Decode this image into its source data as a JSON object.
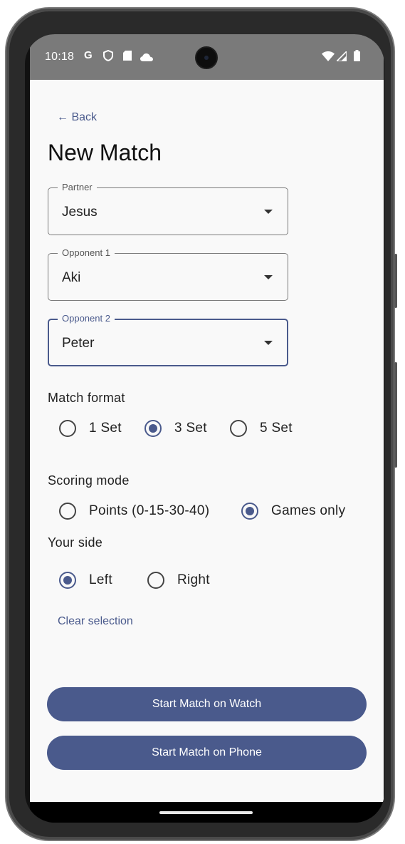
{
  "status_bar": {
    "time": "10:18",
    "left_icons": [
      "google-g-icon",
      "shield-icon",
      "sd-card-icon",
      "cloud-icon"
    ],
    "right_icons": [
      "wifi-icon",
      "signal-icon",
      "battery-icon"
    ]
  },
  "nav": {
    "back_label": "← Back"
  },
  "page": {
    "title": "New Match"
  },
  "form": {
    "partner": {
      "label": "Partner",
      "value": "Jesus"
    },
    "opponent1": {
      "label": "Opponent 1",
      "value": "Aki"
    },
    "opponent2": {
      "label": "Opponent 2",
      "value": "Peter"
    }
  },
  "match_format": {
    "label": "Match format",
    "options": [
      "1 Set",
      "3 Set",
      "5 Set"
    ],
    "selected": "3 Set"
  },
  "scoring_mode": {
    "label": "Scoring mode",
    "options": [
      "Points (0-15-30-40)",
      "Games only"
    ],
    "selected": "Games only"
  },
  "your_side": {
    "label": "Your side",
    "options": [
      "Left",
      "Right"
    ],
    "selected": "Left",
    "clear_label": "Clear selection"
  },
  "actions": {
    "start_watch": "Start Match on Watch",
    "start_phone": "Start Match on Phone"
  },
  "colors": {
    "accent": "#4a5a8c",
    "background": "#f9f9f9",
    "status_bar": "#7a7a7a"
  }
}
